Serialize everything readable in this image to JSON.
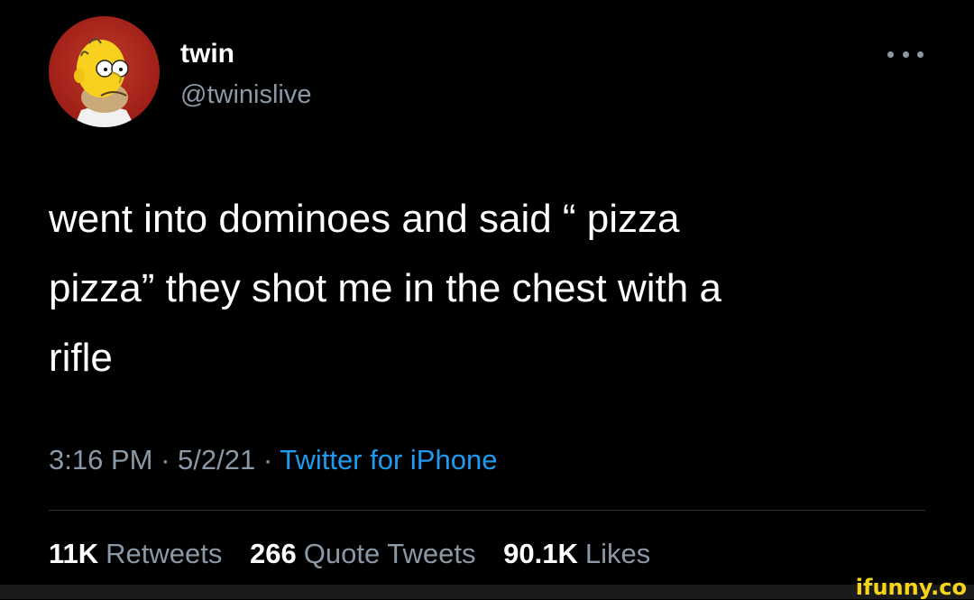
{
  "user": {
    "display_name": "twin",
    "handle": "@twinislive"
  },
  "tweet": {
    "lines": [
      "went into dominoes and said “ pizza",
      "pizza” they shot me in the chest with a",
      "rifle"
    ]
  },
  "meta": {
    "time": "3:16 PM",
    "separator": " · ",
    "date": "5/2/21",
    "separator2": " · ",
    "source": "Twitter for iPhone"
  },
  "stats": {
    "retweets_count": "11K",
    "retweets_label": "Retweets",
    "quotes_count": "266",
    "quotes_label": "Quote Tweets",
    "likes_count": "90.1K",
    "likes_label": "Likes"
  },
  "watermark": {
    "text": "ifunny.co"
  },
  "colors": {
    "background": "#000000",
    "text_primary": "#ffffff",
    "text_secondary": "#8b98a5",
    "link": "#1d9bf0",
    "watermark": "#f5d515"
  },
  "icons": {
    "more": "more-dots-icon",
    "avatar": "homer-simpson-avatar"
  }
}
